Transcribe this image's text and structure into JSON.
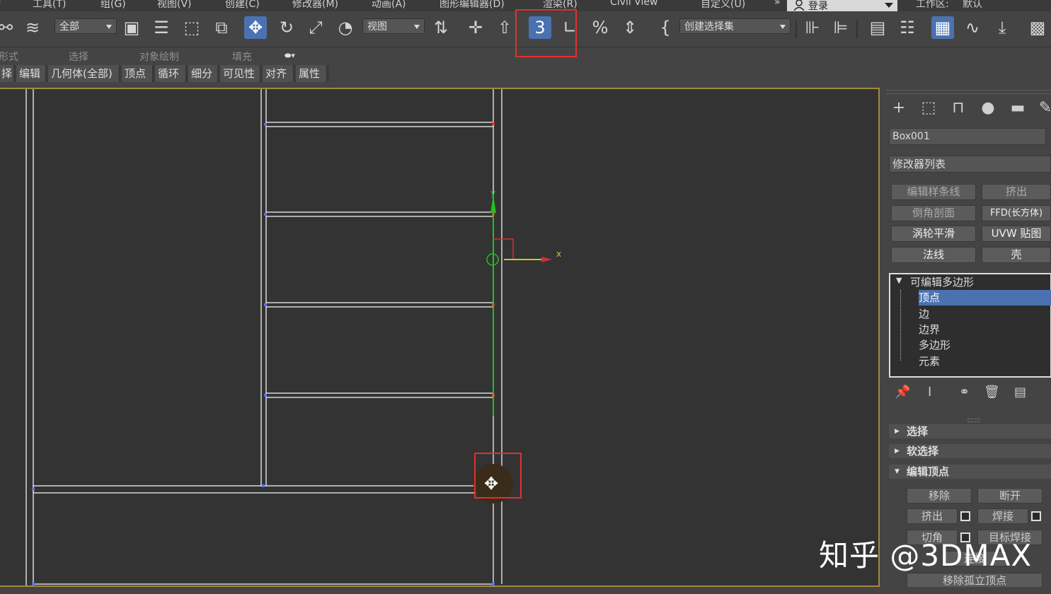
{
  "menu": {
    "items": [
      "工具(T)",
      "组(G)",
      "视图(V)",
      "创建(C)",
      "修改器(M)",
      "动画(A)",
      "图形编辑器(D)",
      "渲染(R)",
      "Civil View",
      "自定义(U)"
    ],
    "more": "»",
    "login": "登录",
    "workspace_label": "工作区:",
    "workspace_value": "默认"
  },
  "toolbar": {
    "selection_filter": "全部",
    "ref_coord": "视图",
    "named_selection": "创建选择集"
  },
  "ribbon": {
    "row1": [
      "形式",
      "选择",
      "对象绘制",
      "填充"
    ],
    "row2": [
      "择",
      "编辑",
      "几何体(全部)",
      "顶点",
      "循环",
      "细分",
      "可见性",
      "对齐",
      "属性"
    ]
  },
  "viewport": {
    "gizmo_x": "x",
    "gizmo_y": "y"
  },
  "command_panel": {
    "object_name": "Box001",
    "modifier_list": "修改器列表",
    "modifier_buttons": [
      "编辑样条线",
      "挤出",
      "倒角剖面",
      "FFD(长方体)",
      "涡轮平滑",
      "UVW 贴图",
      "法线",
      "壳"
    ],
    "stack_title": "可编辑多边形",
    "stack_items": [
      "顶点",
      "边",
      "边界",
      "多边形",
      "元素"
    ],
    "stack_selected": "顶点",
    "rollouts": [
      "选择",
      "软选择",
      "编辑顶点"
    ],
    "vertex_buttons": [
      "移除",
      "断开",
      "挤出",
      "焊接",
      "切角",
      "目标焊接",
      "连接",
      "移除孤立顶点"
    ]
  },
  "watermark": "知乎 @3DMAX",
  "colors": {
    "highlight_frame": "#e23030",
    "selection_blue": "#4a72b0",
    "viewport_border": "#a08a40",
    "gizmo_y_axis": "#22c022",
    "gizmo_x_axis": "#d6c030"
  }
}
